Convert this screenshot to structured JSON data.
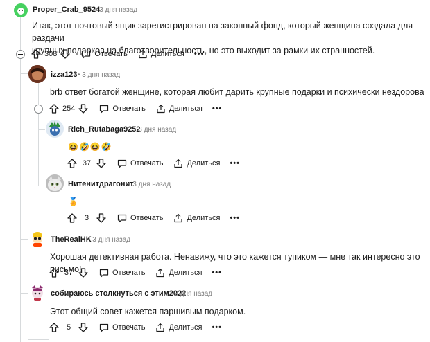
{
  "comments": [
    {
      "username": "Proper_Crab_9524",
      "time": "3 дня назад",
      "text_line1": "Итак, этот почтовый ящик зарегистрирован на законный фонд, который женщина создала для раздачи",
      "text_line2": "крупных подарков на благотворительность, но это выходит за рамки их странностей.",
      "votes": "308",
      "reply_label": "Отвечать",
      "share_label": "Делиться"
    },
    {
      "username": "izza123",
      "time": "3 дня назад",
      "text": "brb ответ богатой женщине, которая любит дарить крупные подарки и психически нездорова",
      "votes": "254",
      "reply_label": "Отвечать",
      "share_label": "Делиться"
    },
    {
      "username": "Rich_Rutabaga9252",
      "time": "3 дня назад",
      "emoji": "😆🤣😆🤣",
      "votes": "37",
      "reply_label": "Отвечать",
      "share_label": "Делиться"
    },
    {
      "username": "Нитенитдрагонит",
      "time": "3 дня назад",
      "emoji": "🏅",
      "votes": "3",
      "reply_label": "Отвечать",
      "share_label": "Делиться"
    },
    {
      "username": "TheRealHK",
      "time": "3 дня назад",
      "text": "Хорошая детективная работа. Ненавижу, что это кажется тупиком — мне так интересно это письмо!",
      "votes": "37",
      "reply_label": "Отвечать",
      "share_label": "Делиться"
    },
    {
      "username": "собираюсь столкнуться с этим2022",
      "time": "3 дня назад",
      "text": "Этот общий совет кажется паршивым подарком.",
      "votes": "5",
      "reply_label": "Отвечать",
      "share_label": "Делиться"
    }
  ],
  "more_label": "•••",
  "dot": "•"
}
